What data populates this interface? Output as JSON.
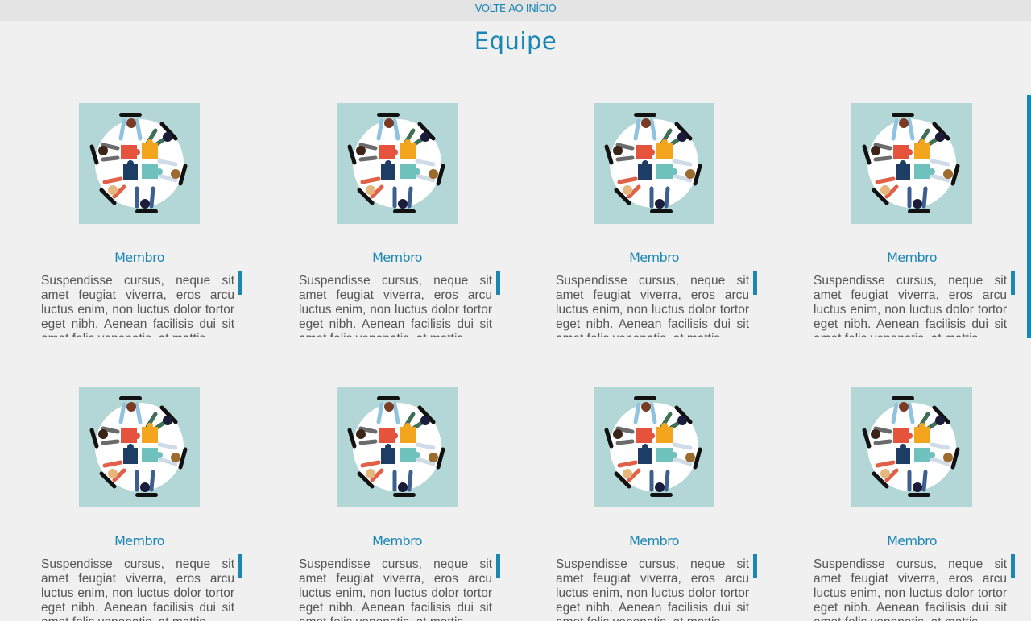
{
  "nav": {
    "back_home": "VOLTE AO INÍCIO"
  },
  "section": {
    "title": "Equipe"
  },
  "image_icon": "team-puzzle-illustration",
  "colors": {
    "accent": "#1a86b4",
    "page_bg": "#f0f0f0",
    "topbar_bg": "#e4e4e4",
    "photo_bg": "#b3d6d7",
    "text": "#555555"
  },
  "members": [
    {
      "name": "Membro",
      "bio": "Suspendisse cursus, neque sit amet feugiat viverra, eros arcu luctus enim, non luctus dolor tortor eget nibh. Aenean facilisis dui sit amet felis venenatis, at mattis"
    },
    {
      "name": "Membro",
      "bio": "Suspendisse cursus, neque sit amet feugiat viverra, eros arcu luctus enim, non luctus dolor tortor eget nibh. Aenean facilisis dui sit amet felis venenatis, at mattis"
    },
    {
      "name": "Membro",
      "bio": "Suspendisse cursus, neque sit amet feugiat viverra, eros arcu luctus enim, non luctus dolor tortor eget nibh. Aenean facilisis dui sit amet felis venenatis, at mattis"
    },
    {
      "name": "Membro",
      "bio": "Suspendisse cursus, neque sit amet feugiat viverra, eros arcu luctus enim, non luctus dolor tortor eget nibh. Aenean facilisis dui sit amet felis venenatis, at mattis"
    },
    {
      "name": "Membro",
      "bio": "Suspendisse cursus, neque sit amet feugiat viverra, eros arcu luctus enim, non luctus dolor tortor eget nibh. Aenean facilisis dui sit amet felis venenatis, at mattis"
    },
    {
      "name": "Membro",
      "bio": "Suspendisse cursus, neque sit amet feugiat viverra, eros arcu luctus enim, non luctus dolor tortor eget nibh. Aenean facilisis dui sit amet felis venenatis, at mattis"
    },
    {
      "name": "Membro",
      "bio": "Suspendisse cursus, neque sit amet feugiat viverra, eros arcu luctus enim, non luctus dolor tortor eget nibh. Aenean facilisis dui sit amet felis venenatis, at mattis"
    },
    {
      "name": "Membro",
      "bio": "Suspendisse cursus, neque sit amet feugiat viverra, eros arcu luctus enim, non luctus dolor tortor eget nibh. Aenean facilisis dui sit amet felis venenatis, at mattis"
    }
  ]
}
